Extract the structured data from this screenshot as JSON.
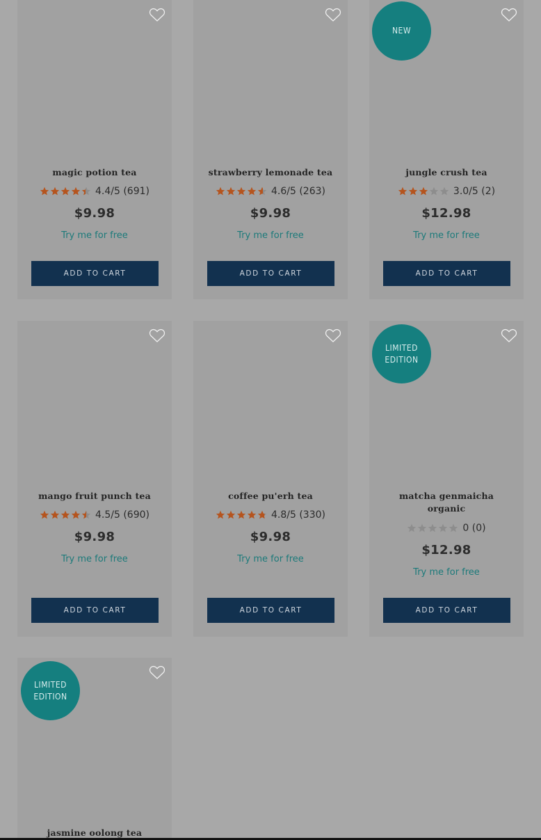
{
  "products": [
    {
      "name": "magic potion tea",
      "stars": 4.4,
      "rating_text": "4.4/5 (691)",
      "price": "$9.98",
      "trial": "Try me for free",
      "cta": "ADD TO CART",
      "badge": ""
    },
    {
      "name": "strawberry lemonade tea",
      "stars": 4.6,
      "rating_text": "4.6/5 (263)",
      "price": "$9.98",
      "trial": "Try me for free",
      "cta": "ADD TO CART",
      "badge": ""
    },
    {
      "name": "jungle crush tea",
      "stars": 3.0,
      "rating_text": "3.0/5 (2)",
      "price": "$12.98",
      "trial": "Try me for free",
      "cta": "ADD TO CART",
      "badge": "NEW"
    },
    {
      "name": "mango fruit punch tea",
      "stars": 4.5,
      "rating_text": "4.5/5 (690)",
      "price": "$9.98",
      "trial": "Try me for free",
      "cta": "ADD TO CART",
      "badge": ""
    },
    {
      "name": "coffee pu'erh tea",
      "stars": 4.8,
      "rating_text": "4.8/5 (330)",
      "price": "$9.98",
      "trial": "Try me for free",
      "cta": "ADD TO CART",
      "badge": ""
    },
    {
      "name": "matcha genmaicha organic",
      "stars": 0,
      "rating_text": "0 (0)",
      "price": "$12.98",
      "trial": "Try me for free",
      "cta": "ADD TO CART",
      "badge": "LIMITED\nEDITION"
    },
    {
      "name": "jasmine oolong tea",
      "stars": null,
      "rating_text": "",
      "price": "",
      "trial": "",
      "cta": "",
      "badge": "LIMITED\nEDITION"
    }
  ],
  "colors": {
    "star_filled": "#b5541e",
    "star_empty": "#8d8d8d",
    "badge_bg": "#157f7f",
    "button_bg": "#12314f",
    "trial_link": "#1c7a7a"
  },
  "icons": {
    "favorite": "heart-outline-icon",
    "star": "star-icon"
  }
}
